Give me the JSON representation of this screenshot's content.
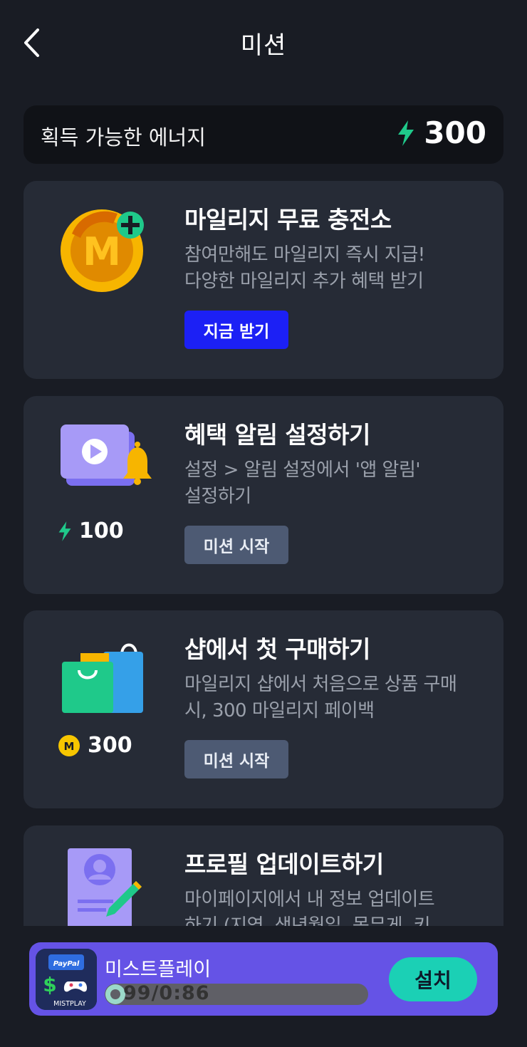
{
  "header": {
    "title": "미션"
  },
  "energy": {
    "label": "획득 가능한 에너지",
    "value": "300"
  },
  "missions": [
    {
      "title": "마일리지 무료 충전소",
      "desc_line1": "참여만해도 마일리지 즉시 지급!",
      "desc_line2": "다양한 마일리지 추가 혜택 받기",
      "button": "지금 받기"
    },
    {
      "title": "혜택 알림 설정하기",
      "desc_line1": "설정 > 알림 설정에서 '앱 알림'",
      "desc_line2": "설정하기",
      "reward": "100",
      "button": "미션 시작"
    },
    {
      "title": "샵에서 첫 구매하기",
      "desc_line1": "마일리지 샵에서 처음으로 상품 구매",
      "desc_line2": "시, 300 마일리지 페이백",
      "reward": "300",
      "button": "미션 시작"
    },
    {
      "title": "프로필 업데이트하기",
      "desc_line1": "마이페이지에서 내 정보 업데이트",
      "desc_line2": "하기 (지역, 생년월일, 몸무게, 키"
    }
  ],
  "ad": {
    "app_name": "미스트플레이",
    "rating_text": "99/0:86",
    "install_label": "설치",
    "icon_brand": "MISTPLAY",
    "icon_badge": "PayPal"
  },
  "colors": {
    "background": "#191c24",
    "card": "#262b36",
    "primary_button": "#1c20f5",
    "secondary_button": "#4d5a73",
    "energy_green": "#1fc98a",
    "ad_background": "#6553e6",
    "install_button": "#1bd0b5"
  }
}
